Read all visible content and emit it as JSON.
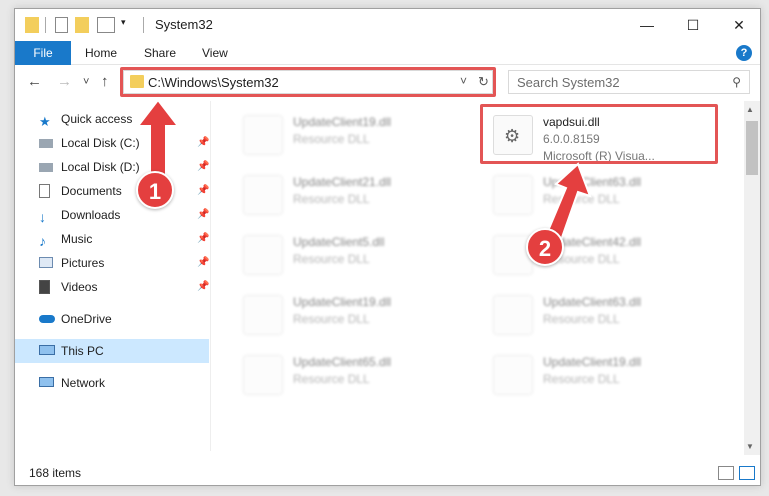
{
  "window": {
    "title": "System32",
    "controls": {
      "minimize": "—",
      "maximize": "☐",
      "close": "✕"
    }
  },
  "ribbon": {
    "tabs": [
      "File",
      "Home",
      "Share",
      "View"
    ],
    "help": "?"
  },
  "address": {
    "path": "C:\\Windows\\System32",
    "refresh": "↻",
    "dropdown": "˅"
  },
  "search": {
    "placeholder": "Search System32",
    "icon": "⚲"
  },
  "nav": {
    "back": "←",
    "forward": "→",
    "recent": "˅",
    "up": "↑"
  },
  "sidebar": {
    "items": [
      {
        "label": "Quick access",
        "icon": "star-icon",
        "pinned": false
      },
      {
        "label": "Local Disk (C:)",
        "icon": "drive-icon",
        "pinned": true
      },
      {
        "label": "Local Disk (D:)",
        "icon": "drive-icon",
        "pinned": true
      },
      {
        "label": "Documents",
        "icon": "documents-icon",
        "pinned": true
      },
      {
        "label": "Downloads",
        "icon": "download-icon",
        "pinned": true
      },
      {
        "label": "Music",
        "icon": "music-icon",
        "pinned": true
      },
      {
        "label": "Pictures",
        "icon": "pictures-icon",
        "pinned": true
      },
      {
        "label": "Videos",
        "icon": "videos-icon",
        "pinned": true
      },
      {
        "label": "OneDrive",
        "icon": "cloud-icon",
        "pinned": false
      },
      {
        "label": "This PC",
        "icon": "computer-icon",
        "pinned": false
      },
      {
        "label": "Network",
        "icon": "network-icon",
        "pinned": false
      }
    ],
    "pin_glyph": "📌"
  },
  "files": {
    "left_column": [
      {
        "name": "UpdateClient19.dll",
        "type": "Resource DLL"
      },
      {
        "name": "UpdateClient21.dll",
        "type": "Resource DLL"
      },
      {
        "name": "UpdateClient5.dll",
        "type": "Resource DLL"
      },
      {
        "name": "UpdateClient19.dll",
        "type": "Resource DLL"
      },
      {
        "name": "UpdateClient65.dll",
        "type": "Resource DLL"
      }
    ],
    "right_column": [
      {
        "name": "vapdsui.dll",
        "version": "6.0.0.8159",
        "company": "Microsoft (R) Visua..."
      },
      {
        "name": "UpdateClient63.dll",
        "type": "Resource DLL"
      },
      {
        "name": "UpdateClient42.dll",
        "type": "Resource DLL"
      },
      {
        "name": "UpdateClient63.dll",
        "type": "Resource DLL"
      },
      {
        "name": "UpdateClient19.dll",
        "type": "Resource DLL"
      }
    ]
  },
  "status": {
    "items": "168 items"
  },
  "annotations": [
    {
      "label": "1"
    },
    {
      "label": "2"
    }
  ],
  "colors": {
    "accent": "#1979ca",
    "highlight": "#e35555",
    "selected": "#cce8ff"
  }
}
